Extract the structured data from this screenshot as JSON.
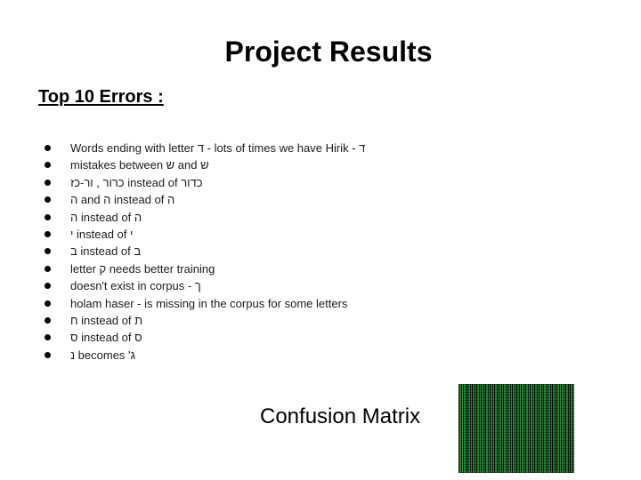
{
  "slide": {
    "title": "Project Results",
    "section_heading": "Top 10 Errors :",
    "errors": [
      "Words ending with letter ד - lots of times we have Hirik - ד",
      "mistakes between ש and ש",
      "כדור instead of כרור , ור-כז",
      "ה instead of ה and ה",
      "ה instead of ה",
      "י instead of י",
      "ב instead of ב",
      "letter ק needs better training",
      "ך - doesn't exist in corpus",
      "holam haser - is missing in the corpus for some letters",
      "ת instead of ח",
      "ס instead of ס",
      "ג' becomes נ"
    ],
    "caption": "Confusion Matrix",
    "image": {
      "icon": "matrix-code-image",
      "accent_color": "#2fa043"
    }
  }
}
